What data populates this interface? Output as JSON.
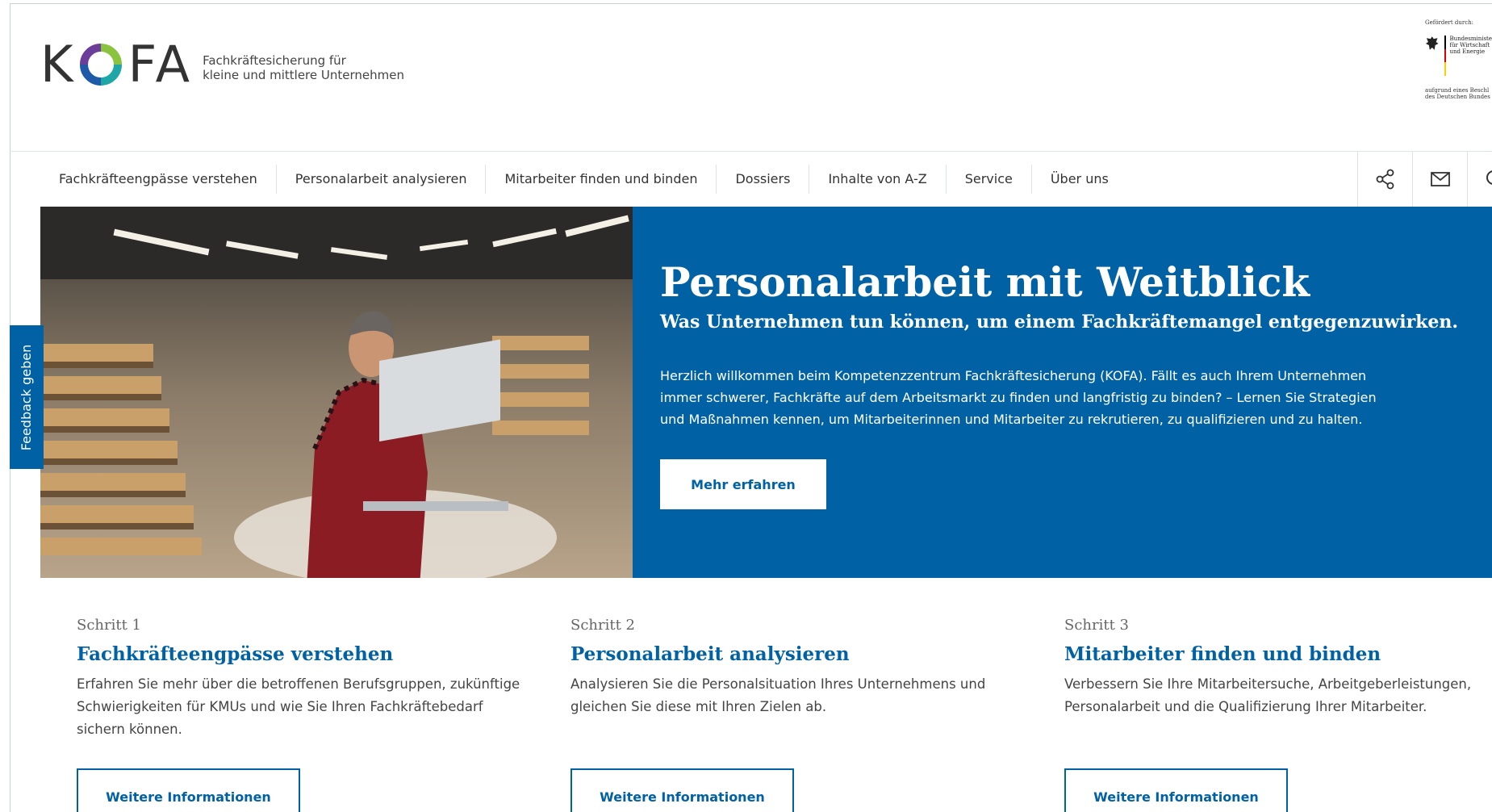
{
  "header": {
    "logo_k": "K",
    "logo_fa": "FA",
    "tagline_line1": "Fachkräftesicherung für",
    "tagline_line2": "kleine und mittlere Unternehmen",
    "funder_top": "Gefördert durch:",
    "ministry_line1": "Bundesministe",
    "ministry_line2": "für Wirtschaft",
    "ministry_line3": "und Energie",
    "funder_bottom_line1": "aufgrund eines Beschl",
    "funder_bottom_line2": "des Deutschen Bundes"
  },
  "nav": {
    "items": [
      {
        "label": "Fachkräfteengpässe verstehen"
      },
      {
        "label": "Personalarbeit analysieren"
      },
      {
        "label": "Mitarbeiter finden und binden"
      },
      {
        "label": "Dossiers"
      },
      {
        "label": "Inhalte von A-Z"
      },
      {
        "label": "Service"
      },
      {
        "label": "Über uns"
      }
    ],
    "icons": [
      "share-icon",
      "mail-icon",
      "search-icon"
    ]
  },
  "hero": {
    "title": "Personalarbeit mit Weitblick",
    "subtitle": "Was Unternehmen tun können, um einem Fachkräftemangel entgegenzuwirken.",
    "text": "Herzlich willkommen beim Kompetenzzentrum Fachkräftesicherung (KOFA). Fällt es auch Ihrem Unternehmen immer schwerer, Fachkräfte auf dem Arbeitsmarkt zu finden und langfristig zu binden? – Lernen Sie Strategien und Maßnahmen kennen, um Mitarbeiterinnen und Mitarbeiter zu rekrutieren, zu qualifizieren und zu halten.",
    "button_label": "Mehr erfahren"
  },
  "feedback": {
    "label": "Feedback geben"
  },
  "steps": [
    {
      "label": "Schritt 1",
      "title": "Fachkräfteengpässe verstehen",
      "text": "Erfahren Sie mehr über die betroffenen Berufsgruppen, zukünftige Schwierigkeiten für KMUs und wie Sie Ihren Fachkräftebedarf sichern können.",
      "button_label": "Weitere Informationen"
    },
    {
      "label": "Schritt 2",
      "title": "Personalarbeit analysieren",
      "text": "Analysieren Sie die Personalsituation Ihres Unternehmens und gleichen Sie diese mit Ihren Zielen ab.",
      "button_label": "Weitere Informationen"
    },
    {
      "label": "Schritt 3",
      "title": "Mitarbeiter finden und binden",
      "text": "Verbessern Sie Ihre Mitarbeitersuche, Arbeitgeberleistungen, Personalarbeit und die Qualifizierung Ihrer Mitarbeiter.",
      "button_label": "Weitere Informationen"
    }
  ],
  "colors": {
    "brand_blue": "#0061a5",
    "text_dark": "#333333"
  }
}
